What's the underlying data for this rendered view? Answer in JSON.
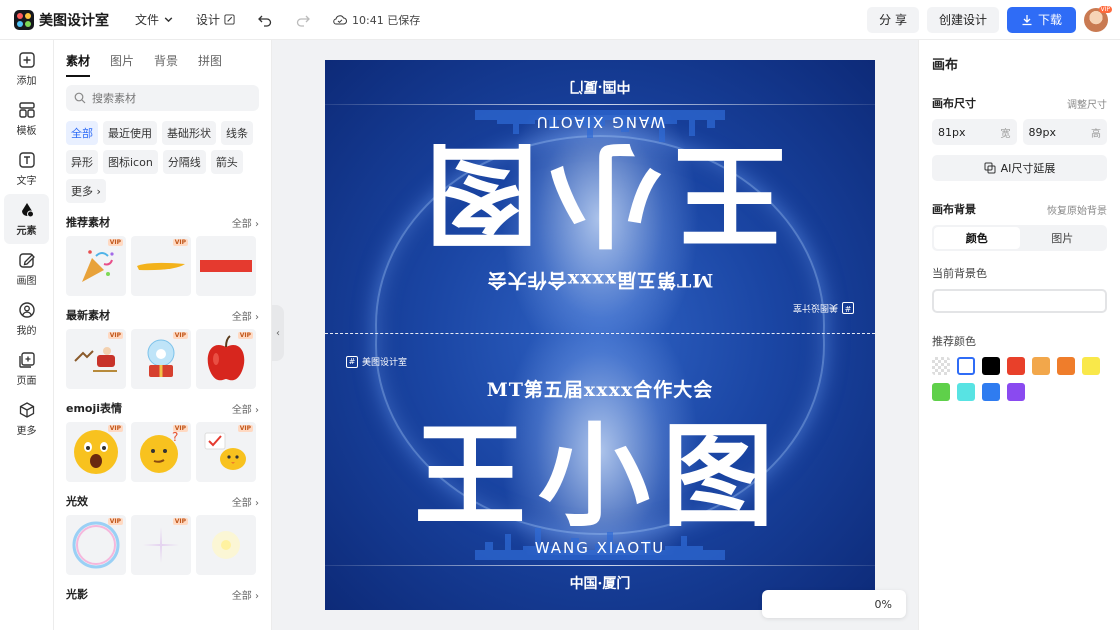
{
  "app": {
    "name": "美图设计室"
  },
  "menu": {
    "file": "文件",
    "design": "设计",
    "saved": "10:41 已保存"
  },
  "topbar": {
    "share": "分 享",
    "create": "创建设计",
    "download": "下载",
    "vip": "VIP"
  },
  "rail": [
    {
      "label": "添加",
      "icon": "plus-square-icon"
    },
    {
      "label": "模板",
      "icon": "template-grid-icon"
    },
    {
      "label": "文字",
      "icon": "text-icon"
    },
    {
      "label": "元素",
      "icon": "elements-icon"
    },
    {
      "label": "画图",
      "icon": "draw-icon"
    },
    {
      "label": "我的",
      "icon": "user-icon"
    },
    {
      "label": "页面",
      "icon": "page-icon"
    },
    {
      "label": "更多",
      "icon": "cube-icon"
    }
  ],
  "panel": {
    "tabs": [
      "素材",
      "图片",
      "背景",
      "拼图"
    ],
    "search_placeholder": "搜索素材",
    "chips": [
      "全部",
      "最近使用",
      "基础形状",
      "线条",
      "异形",
      "图标icon",
      "分隔线",
      "箭头",
      "更多"
    ],
    "sections": [
      {
        "title": "推荐素材",
        "all": "全部"
      },
      {
        "title": "最新素材",
        "all": "全部"
      },
      {
        "title": "emoji表情",
        "all": "全部"
      },
      {
        "title": "光效",
        "all": "全部"
      },
      {
        "title": "光影",
        "all": "全部"
      }
    ],
    "vip_badge": "VIP"
  },
  "canvas": {
    "logo_text": "美图设计室",
    "logo_mark": "#",
    "subtitle": "MT第五届xxxx合作大会",
    "title": "王小图",
    "pinyin": "WANG XIAOTU",
    "place": "中国·厦门",
    "zoom": "0%"
  },
  "right": {
    "title": "画布",
    "size_label": "画布尺寸",
    "size_adjust": "调整尺寸",
    "width_value": "81px",
    "width_unit": "宽",
    "height_value": "89px",
    "height_unit": "高",
    "ai_extend": "AI尺寸延展",
    "bg_label": "画布背景",
    "bg_restore": "恢复原始背景",
    "seg_color": "颜色",
    "seg_image": "图片",
    "current_bg": "当前背景色",
    "recommend": "推荐颜色",
    "swatches": [
      "transparent",
      "#ffffff",
      "#000000",
      "#e8402a",
      "#f2a74b",
      "#ef7d2b",
      "#f9e84a",
      "#5fd04a",
      "#58e3e3",
      "#2f7cf0",
      "#8a4af0"
    ]
  },
  "colors": {
    "accent": "#2f6cf6",
    "canvas_bg": "#1a45a3"
  }
}
